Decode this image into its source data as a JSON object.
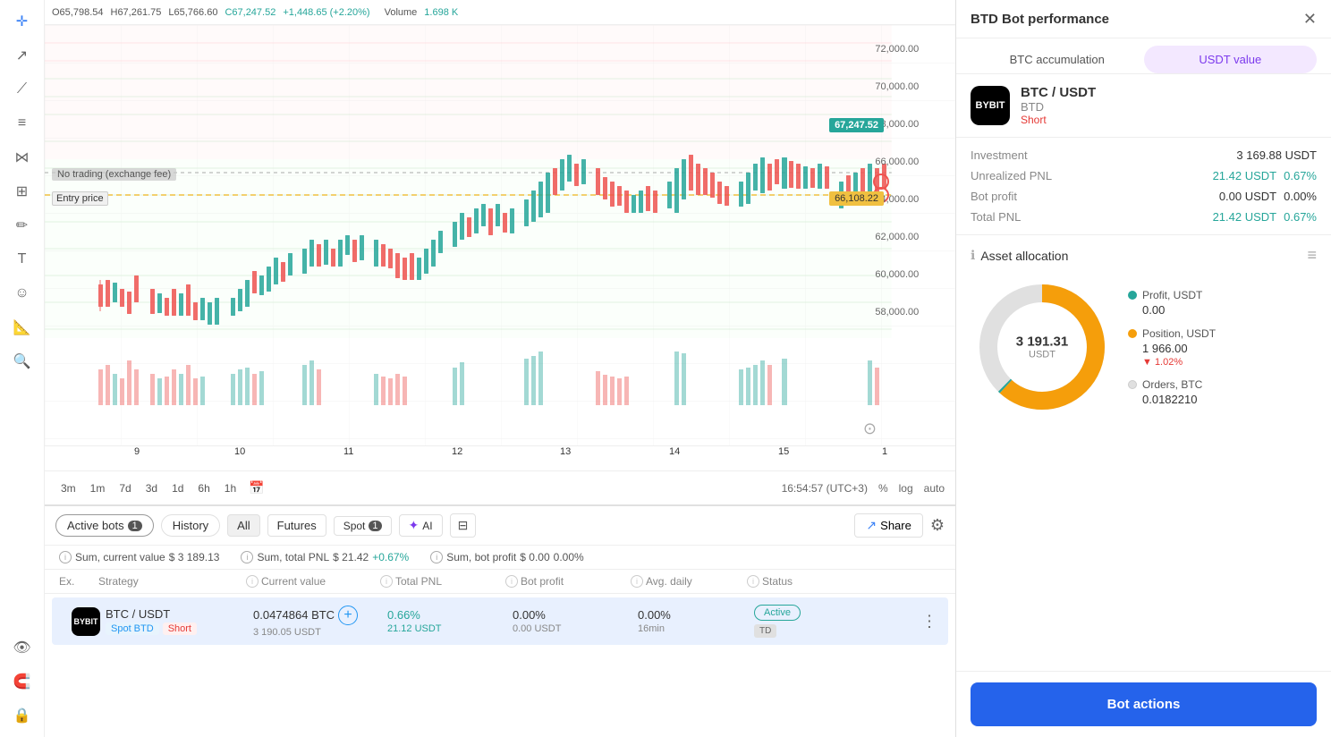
{
  "ohlc": {
    "open": "O65,798.54",
    "high": "H67,261.75",
    "low": "L65,766.60",
    "close": "C67,247.52",
    "change": "+1,448.65 (+2.20%)"
  },
  "volume": {
    "label": "Volume",
    "value": "1.698 K"
  },
  "prices": {
    "current": "67,247.52",
    "entry": "66,108.22",
    "levels": [
      "72,000.00",
      "70,000.00",
      "68,000.00",
      "66,000.00",
      "64,000.00",
      "62,000.00",
      "60,000.00",
      "58,000.00"
    ]
  },
  "chart_labels": {
    "no_trading": "No trading (exchange fee)",
    "entry_price": "Entry price"
  },
  "time_buttons": [
    "3m",
    "1m",
    "7d",
    "3d",
    "1d",
    "6h",
    "1h"
  ],
  "timestamp": "16:54:57 (UTC+3)",
  "right_controls": [
    "%",
    "log",
    "auto"
  ],
  "tabs": {
    "active_bots": "Active bots",
    "active_count": "1",
    "history": "History",
    "all": "All",
    "futures": "Futures",
    "spot": "Spot",
    "spot_count": "1",
    "ai": "AI",
    "share": "Share",
    "filters": "Filters"
  },
  "summary": {
    "current_value_label": "Sum, current value",
    "current_value": "$ 3 189.13",
    "total_pnl_label": "Sum, total PNL",
    "total_pnl_value": "$ 21.42",
    "total_pnl_pct": "+0.67%",
    "bot_profit_label": "Sum, bot profit",
    "bot_profit_value": "$ 0.00",
    "bot_profit_pct": "0.00%"
  },
  "table_headers": {
    "ex": "Ex.",
    "strategy": "Strategy",
    "current_value": "Current value",
    "total_pnl": "Total PNL",
    "bot_profit": "Bot profit",
    "avg_daily": "Avg. daily",
    "status": "Status"
  },
  "bot_row": {
    "pair": "BTC / USDT",
    "exchange_label": "BYBIT",
    "spot_label": "Spot BTD",
    "short_label": "Short",
    "current_btc": "0.0474864 BTC",
    "current_usdt": "3 190.05 USDT",
    "total_pnl_pct": "0.66%",
    "total_pnl_usdt": "21.12 USDT",
    "bot_profit_pct": "0.00%",
    "bot_profit_usdt": "0.00 USDT",
    "avg_daily_pct": "0.00%",
    "avg_daily_time": "16min",
    "status": "Active",
    "status_tag": "TD"
  },
  "right_panel": {
    "title": "BTD Bot performance",
    "tab_btc": "BTC accumulation",
    "tab_usdt": "USDT value",
    "pair": "BTC / USDT",
    "exchange": "BTD",
    "short": "Short",
    "exchange_icon": "BYBIT",
    "investment_label": "Investment",
    "investment_value": "3 169.88 USDT",
    "unrealized_pnl_label": "Unrealized PNL",
    "unrealized_pnl_value": "21.42 USDT",
    "unrealized_pnl_pct": "0.67%",
    "bot_profit_label": "Bot profit",
    "bot_profit_value": "0.00 USDT",
    "bot_profit_pct": "0.00%",
    "total_pnl_label": "Total PNL",
    "total_pnl_value": "21.42 USDT",
    "total_pnl_pct": "0.67%",
    "asset_alloc_title": "Asset allocation",
    "donut_value": "3 191.31",
    "donut_label": "USDT",
    "legend": [
      {
        "name": "Profit, USDT",
        "color": "#26a69a",
        "value": "0.00",
        "sub": "",
        "sub_color": ""
      },
      {
        "name": "Position, USDT",
        "color": "#f59e0b",
        "value": "1 966.00",
        "sub": "▼ 1.02%",
        "sub_color": "#e53935"
      },
      {
        "name": "Orders, BTC",
        "color": "#e0e0e0",
        "value": "0.0182210",
        "sub": "",
        "sub_color": ""
      }
    ],
    "bot_actions_label": "Bot actions"
  }
}
